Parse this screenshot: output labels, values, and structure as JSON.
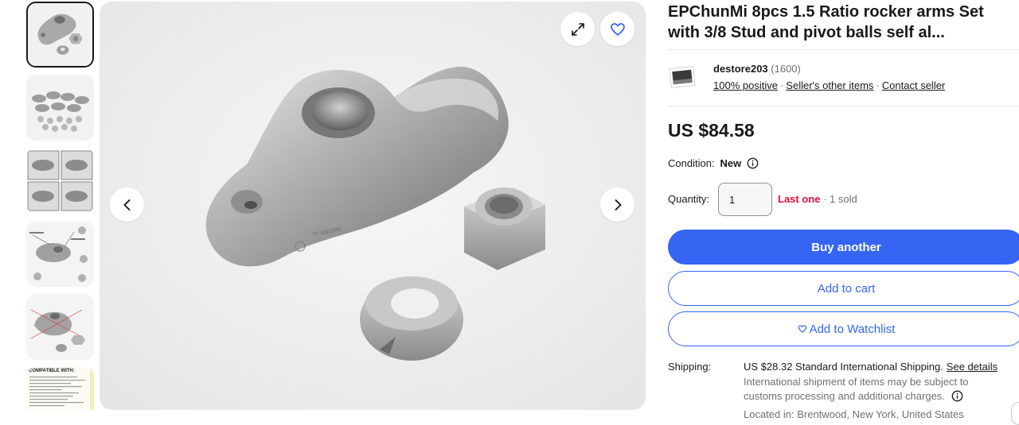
{
  "product": {
    "title": "EPChunMi 8pcs 1.5 Ratio rocker arms Set with 3/8 Stud and pivot balls self al..."
  },
  "gallery": {
    "thumbnails": [
      {
        "name": "thumb-rocker-arm",
        "selected": true
      },
      {
        "name": "thumb-full-set",
        "selected": false
      },
      {
        "name": "thumb-four-angles",
        "selected": false
      },
      {
        "name": "thumb-annotated",
        "selected": false
      },
      {
        "name": "thumb-dimensions",
        "selected": false
      },
      {
        "name": "thumb-compatible",
        "selected": false
      }
    ],
    "thumb_caption": "COMPATIBLE WITH:",
    "icons": {
      "expand": "expand-icon",
      "favorite": "heart-icon",
      "prev": "chevron-left-icon",
      "next": "chevron-right-icon"
    }
  },
  "seller": {
    "name": "destore203",
    "count": "(1600)",
    "positive": "100% positive",
    "other_items": "Seller's other items",
    "contact": "Contact seller"
  },
  "price": "US $84.58",
  "condition": {
    "label": "Condition:",
    "value": "New"
  },
  "quantity": {
    "label": "Quantity:",
    "value": "1",
    "last_one": "Last one",
    "sold": "· 1 sold"
  },
  "actions": {
    "buy": "Buy another",
    "cart": "Add to cart",
    "watch": "Add to Watchlist"
  },
  "shipping": {
    "label": "Shipping:",
    "main": "US $28.32 Standard International Shipping.",
    "details_link": "See details",
    "note": "International shipment of items may be subject to customs processing and additional charges.",
    "location": "Located in: Brentwood, New York, United States"
  },
  "colors": {
    "accent": "#3665f3",
    "alert": "#e0103a",
    "text": "#191919",
    "muted": "#707070"
  }
}
